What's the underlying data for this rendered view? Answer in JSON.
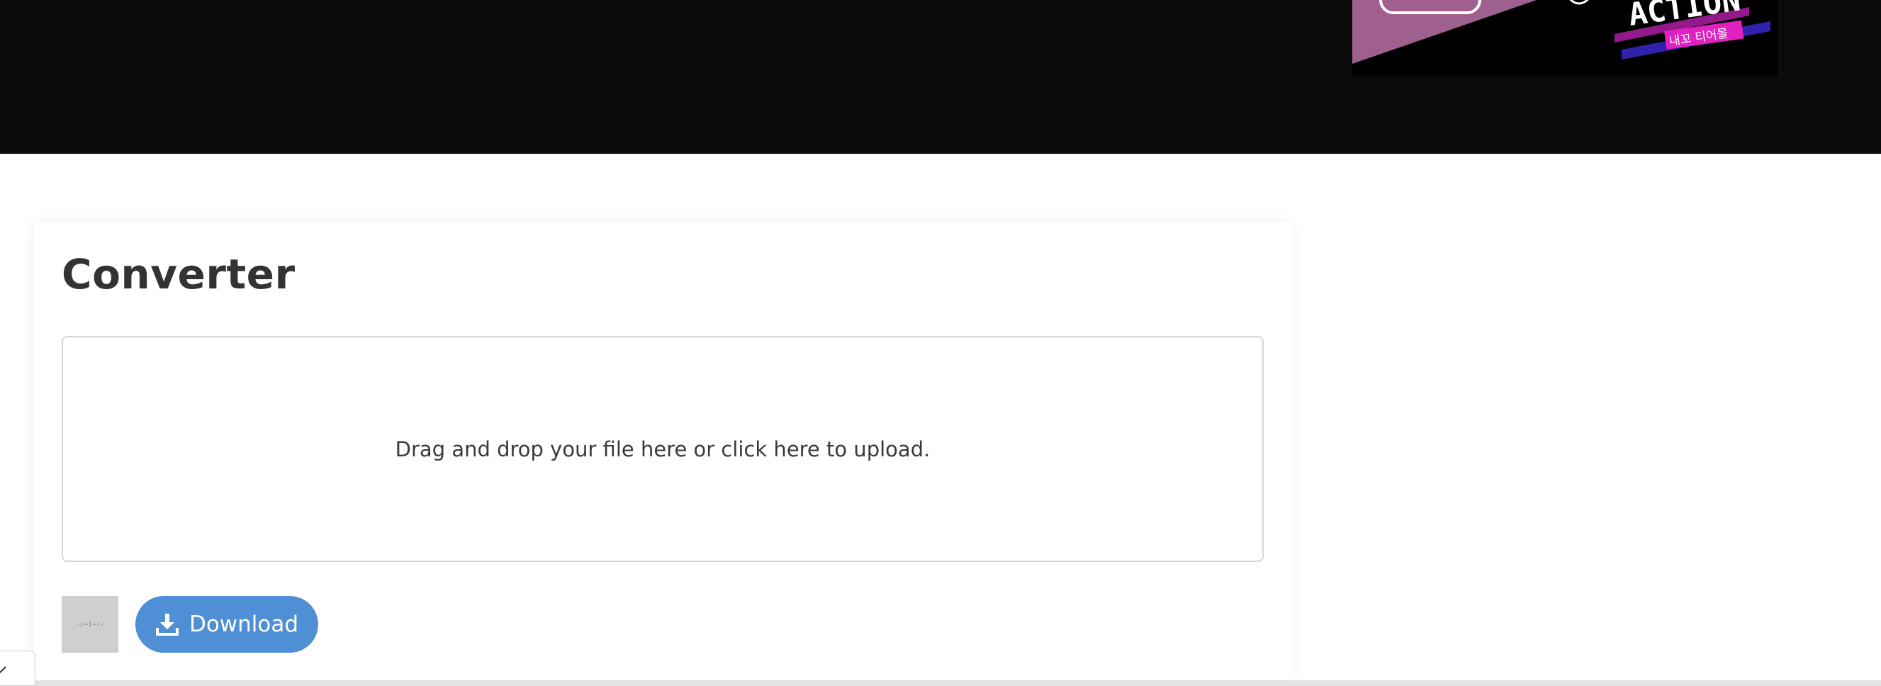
{
  "ad": {
    "headline": "ACTION",
    "subtext": "내꼬 티어몰"
  },
  "converter": {
    "title": "Converter",
    "dropzone_text": "Drag and drop your file here or click here to upload.",
    "download_label": "Download"
  },
  "icons": {
    "audio": "audio-waveform-icon",
    "download": "download-icon",
    "corner": "collapse-arrow-icon"
  },
  "colors": {
    "header_bg": "#0b0b0b",
    "download_button": "#4f8fd6",
    "ad_pink": "#a0608f",
    "ad_magenta": "#e020c0"
  }
}
